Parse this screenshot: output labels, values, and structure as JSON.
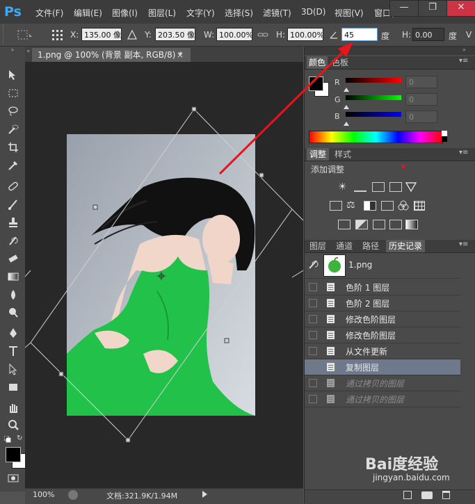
{
  "app": {
    "logo": "Ps"
  },
  "menu": [
    "文件(F)",
    "编辑(E)",
    "图像(I)",
    "图层(L)",
    "文字(Y)",
    "选择(S)",
    "滤镜(T)",
    "3D(D)",
    "视图(V)",
    "窗口("
  ],
  "window_buttons": {
    "minimize": "—",
    "restore": "❐",
    "close": "✕"
  },
  "options": {
    "x_label": "X:",
    "x_value": "135.00 像",
    "y_label": "Y:",
    "y_value": "203.50 像",
    "w_label": "W:",
    "w_value": "100.00%",
    "h_label": "H:",
    "h_value": "100.00%",
    "rotate_value": "45",
    "rotate_unit": "度",
    "hskew_label": "H:",
    "hskew_value": "0.00",
    "hskew_unit": "度",
    "vskew_label": "V"
  },
  "document": {
    "tab_title": "1.png @ 100% (背景 副本, RGB/8) *",
    "close": "×"
  },
  "status": {
    "zoom": "100%",
    "doc_info": "文档:321.9K/1.94M"
  },
  "color_panel": {
    "tabs": [
      "颜色",
      "色板"
    ],
    "channels": [
      {
        "label": "R",
        "value": "0",
        "color": "#e02020"
      },
      {
        "label": "G",
        "value": "0",
        "color": "#20c020"
      },
      {
        "label": "B",
        "value": "0",
        "color": "#2030e0"
      }
    ]
  },
  "adjust_panel": {
    "tabs": [
      "调整",
      "样式"
    ],
    "title": "添加调整"
  },
  "history_panel": {
    "tabs": [
      "图层",
      "通道",
      "路径",
      "历史记录"
    ],
    "snapshot": "1.png",
    "items": [
      "色阶 1 图层",
      "色阶 2 图层",
      "修改色阶图层",
      "修改色阶图层",
      "从文件更新",
      "复制图层",
      "通过拷贝的图层",
      "通过拷贝的图层"
    ],
    "selected_index": 5
  },
  "watermark": {
    "brand": "Bai度经验",
    "url": "jingyan.baidu.com"
  },
  "colors": {
    "accent_arrow": "#e8141a",
    "selection": "#6e7a8c",
    "dress": "#22c24a"
  }
}
